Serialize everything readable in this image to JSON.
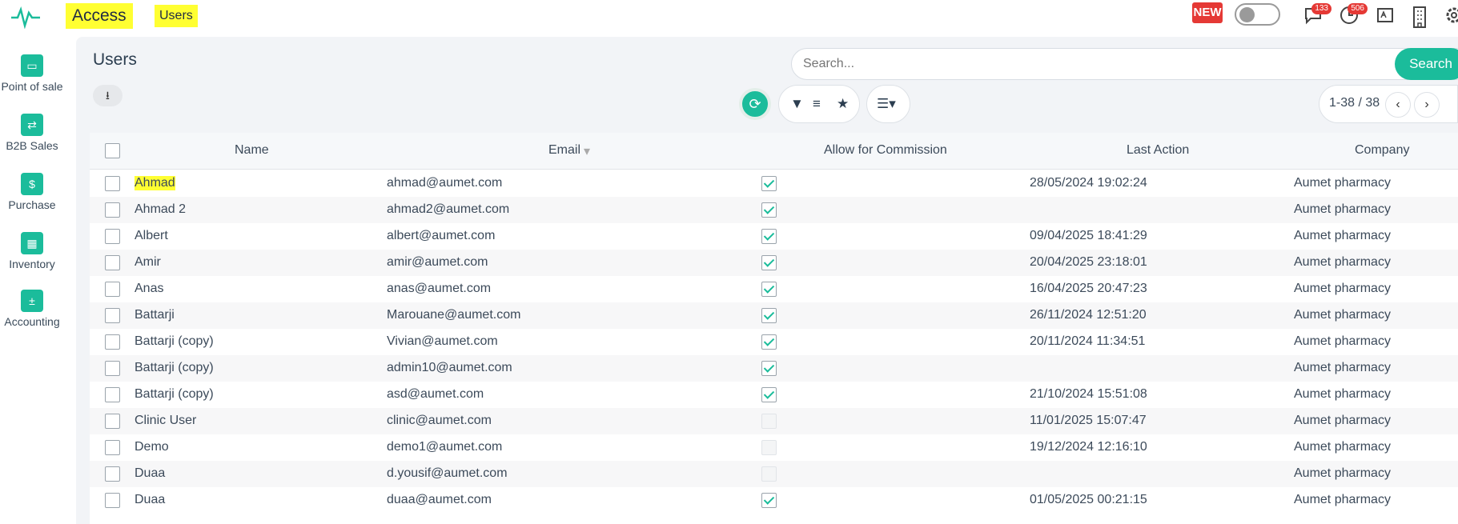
{
  "header": {
    "app_title": "Access",
    "breadcrumb": "Users",
    "new_badge": "NEW",
    "messages_count": "133",
    "activities_count": "506"
  },
  "sidebar": {
    "items": [
      {
        "label": "Point of sale",
        "icon": "pos-icon"
      },
      {
        "label": "B2B Sales",
        "icon": "b2b-sales-icon"
      },
      {
        "label": "Purchase",
        "icon": "purchase-icon"
      },
      {
        "label": "Inventory",
        "icon": "inventory-icon"
      },
      {
        "label": "Accounting",
        "icon": "accounting-icon"
      }
    ]
  },
  "page": {
    "title": "Users"
  },
  "search": {
    "placeholder": "Search...",
    "button": "Search"
  },
  "pager": {
    "range": "1-38 / 38"
  },
  "table": {
    "columns": [
      "Name",
      "Email",
      "Allow for Commission",
      "Last Action",
      "Company"
    ],
    "rows": [
      {
        "name": "Ahmad",
        "email": "ahmad@aumet.com",
        "commission": true,
        "last_action": "28/05/2024 19:02:24",
        "company": "Aumet pharmacy"
      },
      {
        "name": "Ahmad 2",
        "email": "ahmad2@aumet.com",
        "commission": true,
        "last_action": "",
        "company": "Aumet pharmacy"
      },
      {
        "name": "Albert",
        "email": "albert@aumet.com",
        "commission": true,
        "last_action": "09/04/2025 18:41:29",
        "company": "Aumet pharmacy"
      },
      {
        "name": "Amir",
        "email": "amir@aumet.com",
        "commission": true,
        "last_action": "20/04/2025 23:18:01",
        "company": "Aumet pharmacy"
      },
      {
        "name": "Anas",
        "email": "anas@aumet.com",
        "commission": true,
        "last_action": "16/04/2025 20:47:23",
        "company": "Aumet pharmacy"
      },
      {
        "name": "Battarji",
        "email": "Marouane@aumet.com",
        "commission": true,
        "last_action": "26/11/2024 12:51:20",
        "company": "Aumet pharmacy"
      },
      {
        "name": "Battarji (copy)",
        "email": "Vivian@aumet.com",
        "commission": true,
        "last_action": "20/11/2024 11:34:51",
        "company": "Aumet pharmacy"
      },
      {
        "name": "Battarji (copy)",
        "email": "admin10@aumet.com",
        "commission": true,
        "last_action": "",
        "company": "Aumet pharmacy"
      },
      {
        "name": "Battarji (copy)",
        "email": "asd@aumet.com",
        "commission": true,
        "last_action": "21/10/2024 15:51:08",
        "company": "Aumet pharmacy"
      },
      {
        "name": "Clinic User",
        "email": "clinic@aumet.com",
        "commission": false,
        "last_action": "11/01/2025 15:07:47",
        "company": "Aumet pharmacy"
      },
      {
        "name": "Demo",
        "email": "demo1@aumet.com",
        "commission": false,
        "last_action": "19/12/2024 12:16:10",
        "company": "Aumet pharmacy"
      },
      {
        "name": "Duaa",
        "email": "d.yousif@aumet.com",
        "commission": false,
        "last_action": "",
        "company": "Aumet pharmacy"
      },
      {
        "name": "Duaa",
        "email": "duaa@aumet.com",
        "commission": true,
        "last_action": "01/05/2025 00:21:15",
        "company": "Aumet pharmacy"
      }
    ]
  }
}
